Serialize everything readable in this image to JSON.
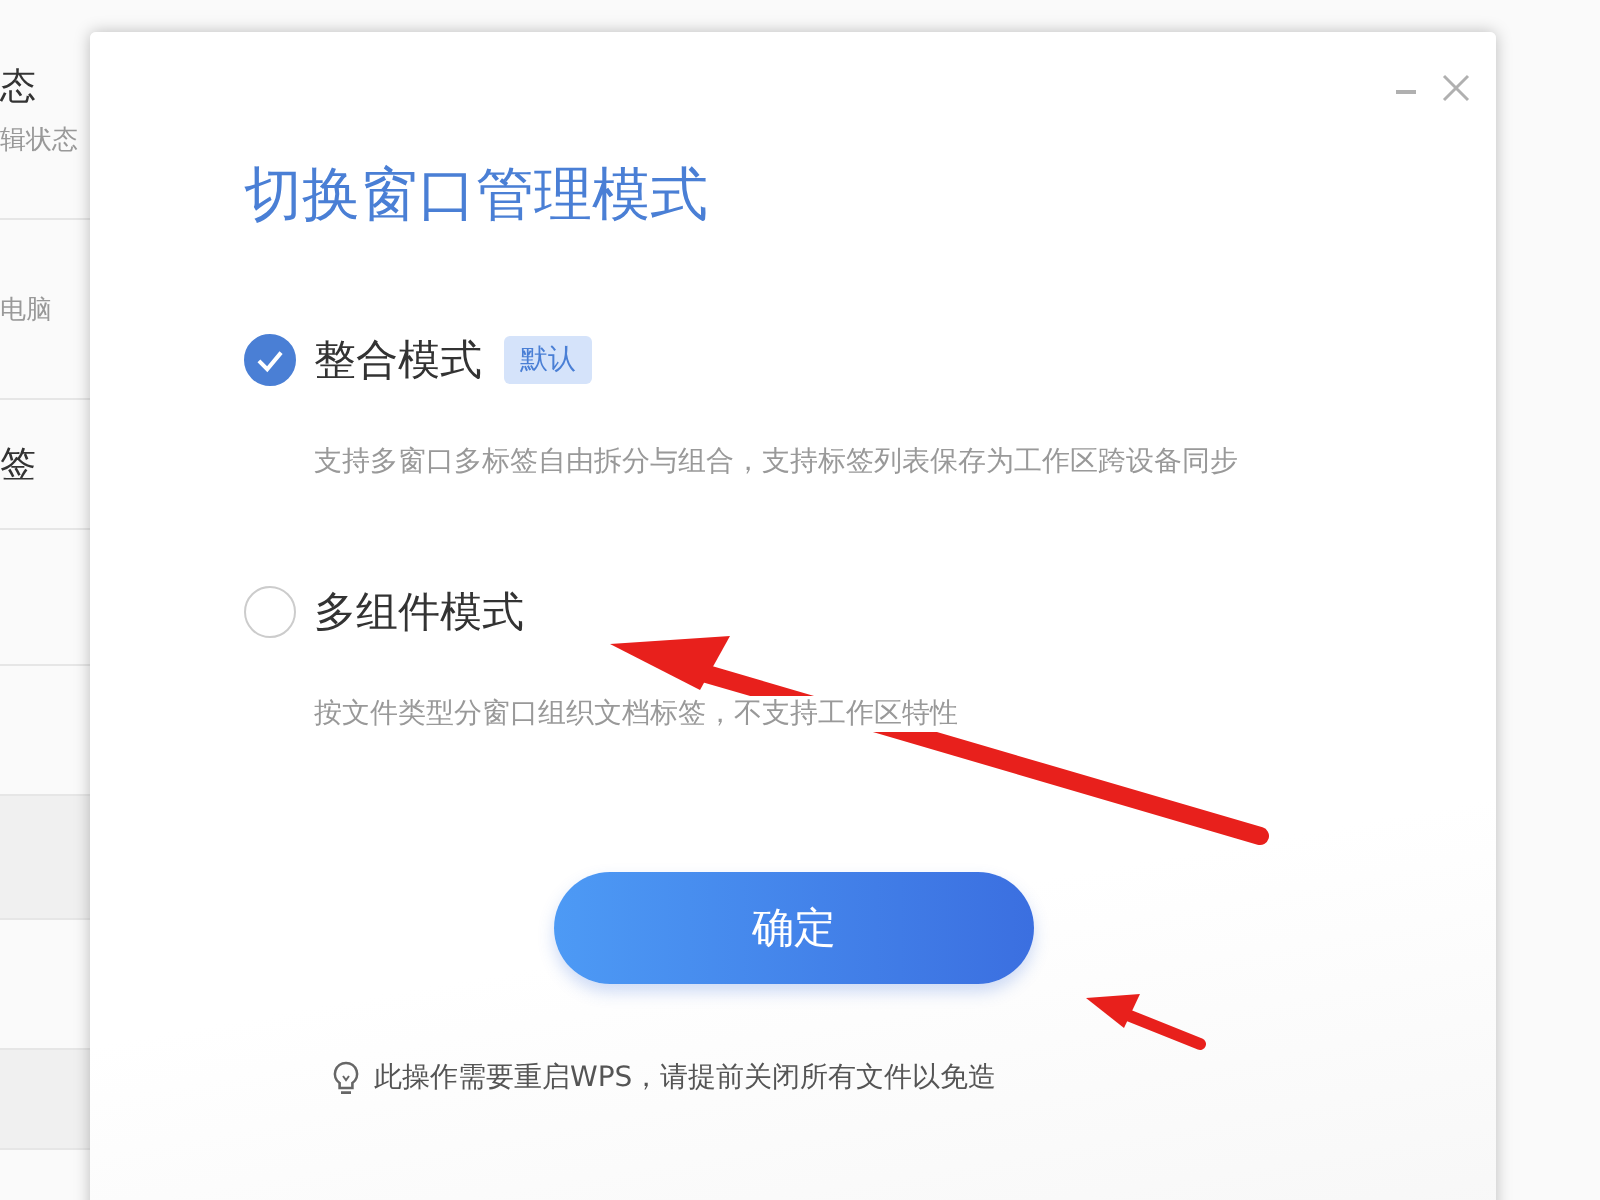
{
  "background_list": [
    {
      "title": "态",
      "subtitle": "辑状态"
    },
    {
      "subtitle": "电脑"
    },
    {
      "title": "签"
    }
  ],
  "dialog": {
    "title": "切换窗口管理模式",
    "options": [
      {
        "label": "整合模式",
        "badge": "默认",
        "description": "支持多窗口多标签自由拆分与组合，支持标签列表保存为工作区跨设备同步",
        "selected": true
      },
      {
        "label": "多组件模式",
        "description": "按文件类型分窗口组织文档标签，不支持工作区特性",
        "selected": false
      }
    ],
    "confirm_button": "确定",
    "hint": "此操作需要重启WPS，请提前关闭所有文件以免造"
  }
}
